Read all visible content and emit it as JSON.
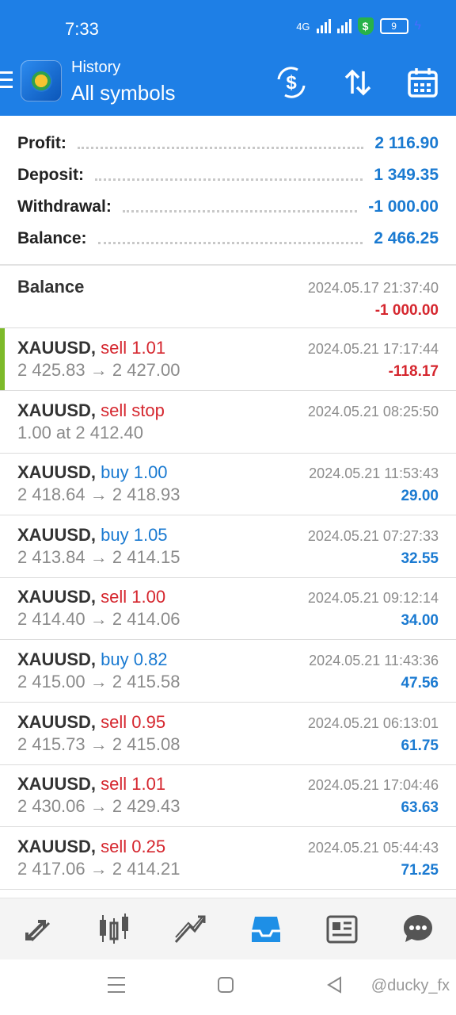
{
  "status_bar": {
    "time": "7:33",
    "network": "4G",
    "battery": "9"
  },
  "toolbar": {
    "title": "History",
    "subtitle": "All symbols"
  },
  "summary": [
    {
      "label": "Profit:",
      "value": "2 116.90"
    },
    {
      "label": "Deposit:",
      "value": "1 349.35"
    },
    {
      "label": "Withdrawal:",
      "value": "-1 000.00"
    },
    {
      "label": "Balance:",
      "value": "2 466.25"
    }
  ],
  "balance_entry": {
    "title": "Balance",
    "timestamp": "2024.05.17 21:37:40",
    "amount": "-1 000.00"
  },
  "trades": [
    {
      "symbol": "XAUUSD,",
      "action": "sell 1.01",
      "side": "sell",
      "prices": "2 425.83 → 2 427.00",
      "timestamp": "2024.05.21 17:17:44",
      "profit": "-118.17",
      "profit_color": "red"
    },
    {
      "symbol": "XAUUSD,",
      "action": "sell stop",
      "side": "sell",
      "prices": "1.00 at 2 412.40",
      "timestamp": "2024.05.21 08:25:50",
      "profit": "",
      "profit_color": "blue"
    },
    {
      "symbol": "XAUUSD,",
      "action": "buy 1.00",
      "side": "buy",
      "prices": "2 418.64 → 2 418.93",
      "timestamp": "2024.05.21 11:53:43",
      "profit": "29.00",
      "profit_color": "blue"
    },
    {
      "symbol": "XAUUSD,",
      "action": "buy 1.05",
      "side": "buy",
      "prices": "2 413.84 → 2 414.15",
      "timestamp": "2024.05.21 07:27:33",
      "profit": "32.55",
      "profit_color": "blue"
    },
    {
      "symbol": "XAUUSD,",
      "action": "sell 1.00",
      "side": "sell",
      "prices": "2 414.40 → 2 414.06",
      "timestamp": "2024.05.21 09:12:14",
      "profit": "34.00",
      "profit_color": "blue"
    },
    {
      "symbol": "XAUUSD,",
      "action": "buy 0.82",
      "side": "buy",
      "prices": "2 415.00 → 2 415.58",
      "timestamp": "2024.05.21 11:43:36",
      "profit": "47.56",
      "profit_color": "blue"
    },
    {
      "symbol": "XAUUSD,",
      "action": "sell 0.95",
      "side": "sell",
      "prices": "2 415.73 → 2 415.08",
      "timestamp": "2024.05.21 06:13:01",
      "profit": "61.75",
      "profit_color": "blue"
    },
    {
      "symbol": "XAUUSD,",
      "action": "sell 1.01",
      "side": "sell",
      "prices": "2 430.06 → 2 429.43",
      "timestamp": "2024.05.21 17:04:46",
      "profit": "63.63",
      "profit_color": "blue"
    },
    {
      "symbol": "XAUUSD,",
      "action": "sell 0.25",
      "side": "sell",
      "prices": "2 417.06 → 2 414.21",
      "timestamp": "2024.05.21 05:44:43",
      "profit": "71.25",
      "profit_color": "blue"
    }
  ],
  "bottom_nav": [
    {
      "icon": "quotes-icon"
    },
    {
      "icon": "chart-icon"
    },
    {
      "icon": "trade-icon"
    },
    {
      "icon": "history-icon"
    },
    {
      "icon": "news-icon"
    },
    {
      "icon": "chat-icon"
    }
  ],
  "watermark": "@ducky_fx",
  "colors": {
    "accent": "#1e7fe6",
    "sell": "#d5262e",
    "buy": "#1a7ad1",
    "active_nav": "#1e8fe6"
  }
}
